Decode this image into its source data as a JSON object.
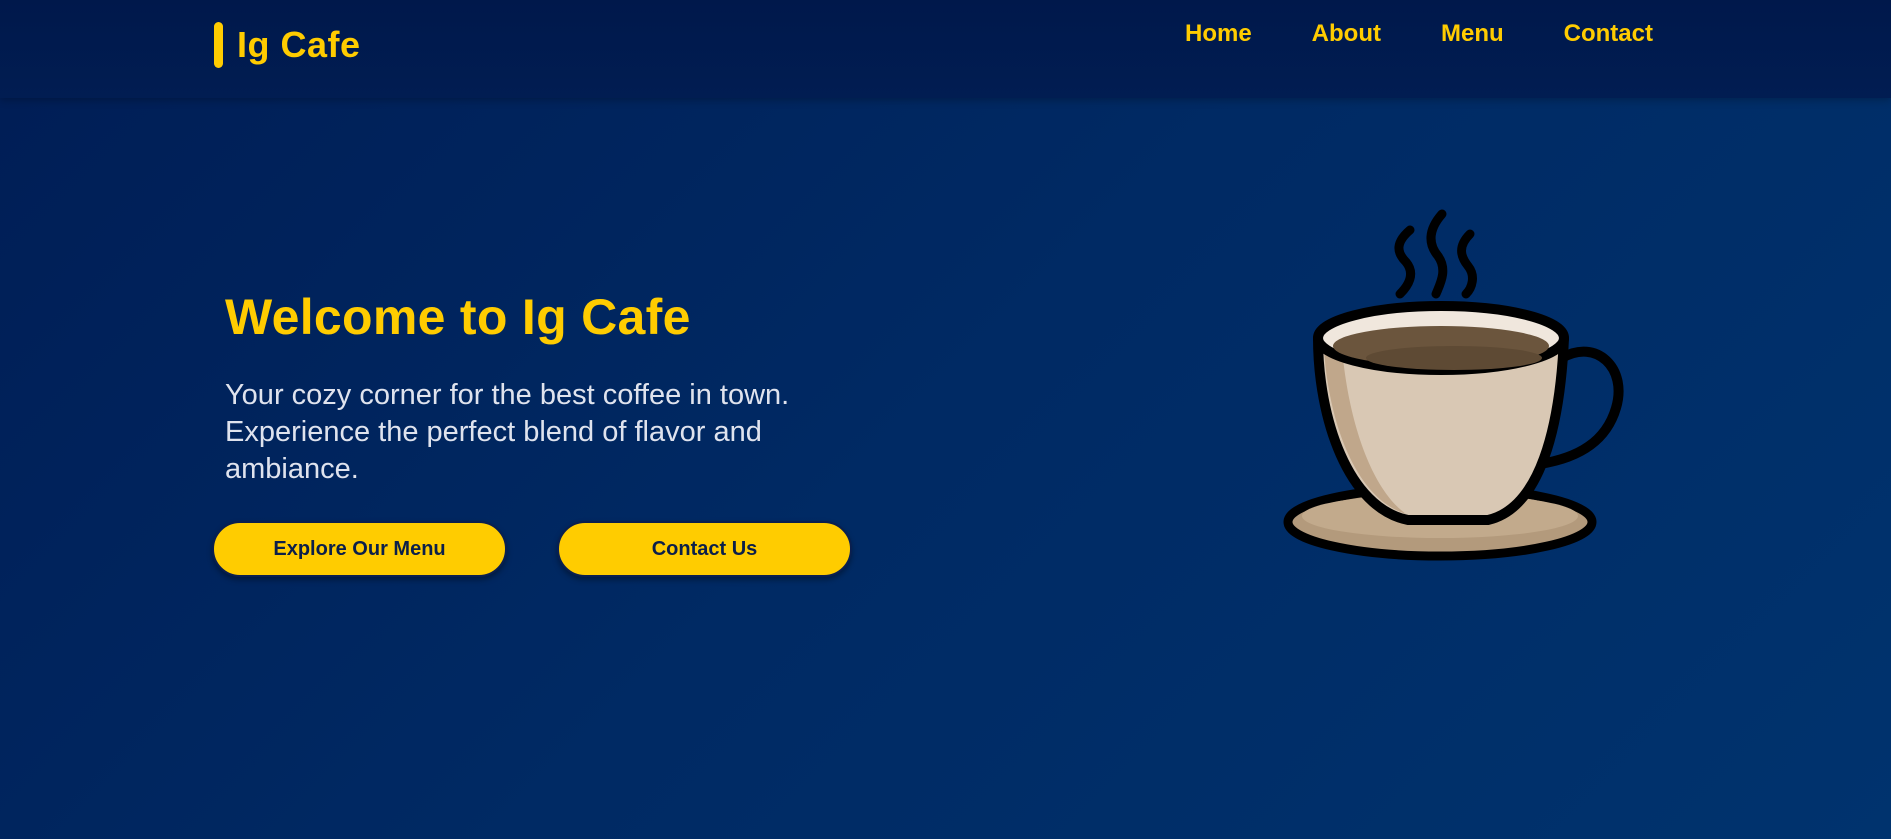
{
  "header": {
    "brand": "Ig Cafe",
    "nav": [
      {
        "label": "Home"
      },
      {
        "label": "About"
      },
      {
        "label": "Menu"
      },
      {
        "label": "Contact"
      }
    ]
  },
  "hero": {
    "title": "Welcome to Ig Cafe",
    "subtitle": "Your cozy corner for the best coffee in town. Experience the perfect blend of flavor and ambiance.",
    "buttons": {
      "primary": "Explore Our Menu",
      "secondary": "Contact Us"
    },
    "illustration": "coffee-cup-icon"
  },
  "colors": {
    "accent": "#ffcc00",
    "background": "#002a64",
    "header": "#00184b",
    "text": "#dfe3ee"
  }
}
